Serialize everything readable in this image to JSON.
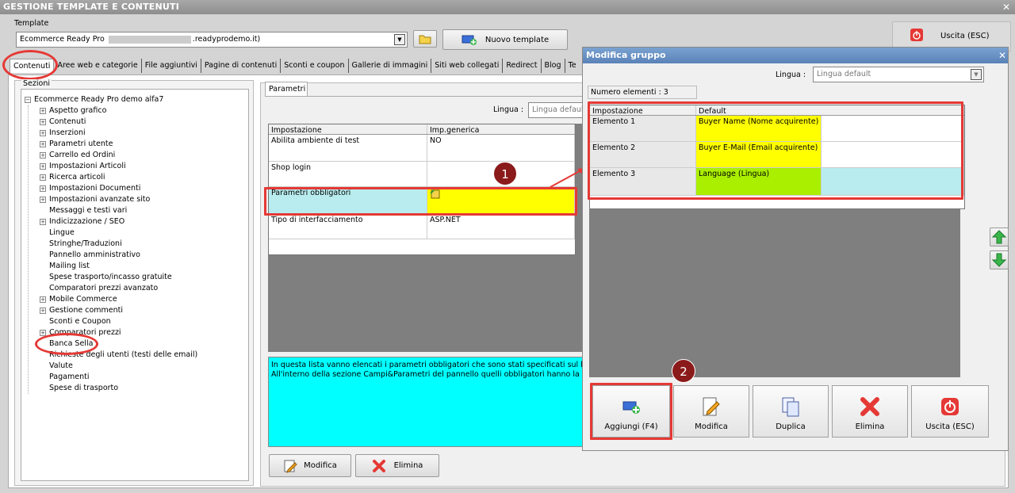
{
  "window": {
    "title": "GESTIONE TEMPLATE E CONTENUTI",
    "close": "✕"
  },
  "template": {
    "label": "Template",
    "value_prefix": "Ecommerce Ready Pro",
    "value_suffix": ".readyprodemo.it)",
    "new_button": "Nuovo template"
  },
  "exit_button": "Uscita (ESC)",
  "tabs": [
    "Contenuti",
    "Aree web e categorie",
    "File aggiuntivi",
    "Pagine di contenuti",
    "Sconti e coupon",
    "Gallerie di immagini",
    "Siti web collegati",
    "Redirect",
    "Blog",
    "Te"
  ],
  "sections": {
    "label": "Sezioni",
    "root": "Ecommerce Ready Pro demo alfa7",
    "items": [
      {
        "label": "Aspetto grafico",
        "expandable": true
      },
      {
        "label": "Contenuti",
        "expandable": true
      },
      {
        "label": "Inserzioni",
        "expandable": true
      },
      {
        "label": "Parametri utente",
        "expandable": true
      },
      {
        "label": "Carrello ed Ordini",
        "expandable": true
      },
      {
        "label": "Impostazioni Articoli",
        "expandable": true
      },
      {
        "label": "Ricerca articoli",
        "expandable": true
      },
      {
        "label": "Impostazioni Documenti",
        "expandable": true
      },
      {
        "label": "Impostazioni avanzate sito",
        "expandable": true
      },
      {
        "label": "Messaggi e testi vari",
        "expandable": false
      },
      {
        "label": "Indicizzazione / SEO",
        "expandable": true
      },
      {
        "label": "Lingue",
        "expandable": false
      },
      {
        "label": "Stringhe/Traduzioni",
        "expandable": false
      },
      {
        "label": "Pannello amministrativo",
        "expandable": false
      },
      {
        "label": "Mailing list",
        "expandable": false
      },
      {
        "label": "Spese trasporto/incasso gratuite",
        "expandable": false
      },
      {
        "label": "Comparatori prezzi avanzato",
        "expandable": false
      },
      {
        "label": "Mobile Commerce",
        "expandable": true
      },
      {
        "label": "Gestione commenti",
        "expandable": true
      },
      {
        "label": "Sconti e Coupon",
        "expandable": false
      },
      {
        "label": "Comparatori prezzi",
        "expandable": true
      },
      {
        "label": "Banca Sella",
        "expandable": false
      },
      {
        "label": "Richieste degli utenti (testi delle email)",
        "expandable": false
      },
      {
        "label": "Valute",
        "expandable": false
      },
      {
        "label": "Pagamenti",
        "expandable": false
      },
      {
        "label": "Spese di trasporto",
        "expandable": false
      }
    ]
  },
  "params": {
    "tab": "Parametri",
    "lingua_label": "Lingua :",
    "lingua_value": "Lingua default",
    "columns": [
      "Impostazione",
      "Imp.generica"
    ],
    "rows": [
      {
        "setting": "Abilita ambiente di test",
        "value": "NO"
      },
      {
        "setting": "Shop login",
        "value": ""
      },
      {
        "setting": "Parametri obbligatori",
        "value": ""
      },
      {
        "setting": "Tipo di interfacciamento",
        "value": "ASP.NET"
      }
    ],
    "description_line1": "In questa lista vanno elencati i parametri obbligatori che sono stati specificati sul backoffi",
    "description_line2": "All'interno della sezione Campi&Parametri del pannello quelli obbligatori hanno la colonn",
    "modify_button": "Modifica",
    "delete_button": "Elimina"
  },
  "modal": {
    "title": "Modifica gruppo",
    "lingua_label": "Lingua :",
    "lingua_value": "Lingua default",
    "count_label": "Numero elementi : 3",
    "columns": [
      "Impostazione",
      "Default"
    ],
    "rows": [
      {
        "setting": "Elemento 1",
        "value": "Buyer Name (Nome acquirente)",
        "color": "#ffff00"
      },
      {
        "setting": "Elemento 2",
        "value": "Buyer E-Mail (Email acquirente)",
        "color": "#ffff00"
      },
      {
        "setting": "Elemento 3",
        "value": "Language (Lingua)",
        "color": "#aaee00"
      }
    ],
    "buttons": [
      "Aggiungi (F4)",
      "Modifica",
      "Duplica",
      "Elimina",
      "Uscita (ESC)"
    ]
  },
  "annotations": {
    "badge1": "1",
    "badge2": "2"
  },
  "colors": {
    "highlight_yellow": "#ffff00",
    "highlight_cyan": "#b8ecee",
    "annotation_red": "#e53935",
    "description_bg": "#00ffff"
  }
}
